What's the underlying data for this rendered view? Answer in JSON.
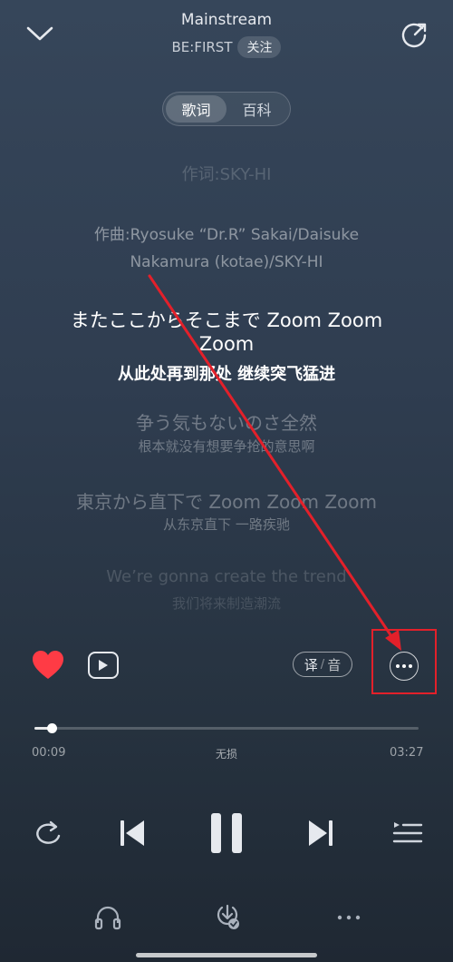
{
  "header": {
    "song_title": "Mainstream",
    "artist": "BE:FIRST",
    "follow_label": "关注"
  },
  "tabs": [
    {
      "label": "歌词",
      "active": true
    },
    {
      "label": "百科",
      "active": false
    }
  ],
  "lyrics": {
    "line_lyricist": "作词:SKY-HI",
    "line_composer_1": "作曲:Ryosuke “Dr.R” Sakai/Daisuke",
    "line_composer_2": "Nakamura (kotae)/SKY-HI",
    "current_line_1": "またここからそこまで Zoom Zoom",
    "current_line_2": "Zoom",
    "current_translation": "从此处再到那处 继续突飞猛进",
    "next_line": "争う気もないのさ全然",
    "next_translation": "根本就没有想要争抢的意思啊",
    "line_3": "東京から直下で Zoom Zoom Zoom",
    "line_3_translation": "从东京直下 一路疾驰",
    "line_4": "We’re gonna create the trend",
    "line_4_translation": "我们将来制造潮流"
  },
  "actions": {
    "translate_label": "译",
    "phonetic_label": "音",
    "separator": "/"
  },
  "playback": {
    "current_time": "00:09",
    "total_time": "03:27",
    "quality": "无损",
    "progress": 0.045
  },
  "colors": {
    "like": "#ff3b45",
    "annotation": "#e3202a"
  },
  "icons": {
    "collapse": "chevron-down-icon",
    "share": "share-icon",
    "like": "heart-icon",
    "mv": "play-icon",
    "more": "ellipsis-icon",
    "repeat": "repeat-icon",
    "prev": "skip-previous-icon",
    "pause": "pause-icon",
    "next": "skip-next-icon",
    "playlist": "playlist-icon",
    "headphone": "headphones-icon",
    "download": "download-icon"
  }
}
